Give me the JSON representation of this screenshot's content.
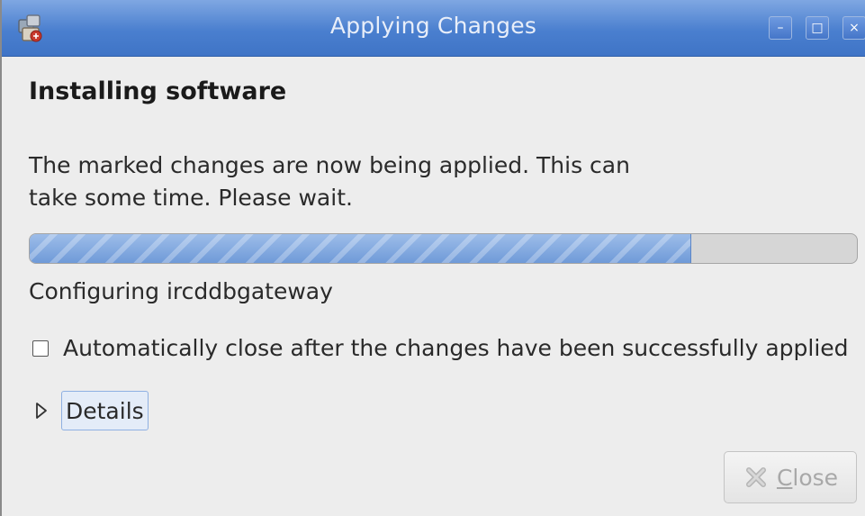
{
  "window": {
    "title": "Applying Changes",
    "controls": {
      "minimize_glyph": "–",
      "maximize_glyph": "□",
      "close_glyph": "×"
    }
  },
  "heading": "Installing software",
  "description": "The marked changes are now being applied. This can take some time. Please wait.",
  "progress": {
    "fraction": 0.8,
    "status_text": "Configuring ircddbgateway"
  },
  "auto_close": {
    "checked": false,
    "label": "Automatically close after the changes have been successfully applied"
  },
  "details": {
    "label": "Details",
    "expanded": false
  },
  "close_button": {
    "mnemonic": "C",
    "rest": "lose",
    "enabled": false,
    "icon": "close-x-icon"
  },
  "colors": {
    "titlebar": "#4a7fcf",
    "progress_fill": "#7fa6de",
    "window_bg": "#ededed"
  },
  "icons": {
    "app": "package-manager-icon",
    "details": "expander-triangle-icon"
  }
}
